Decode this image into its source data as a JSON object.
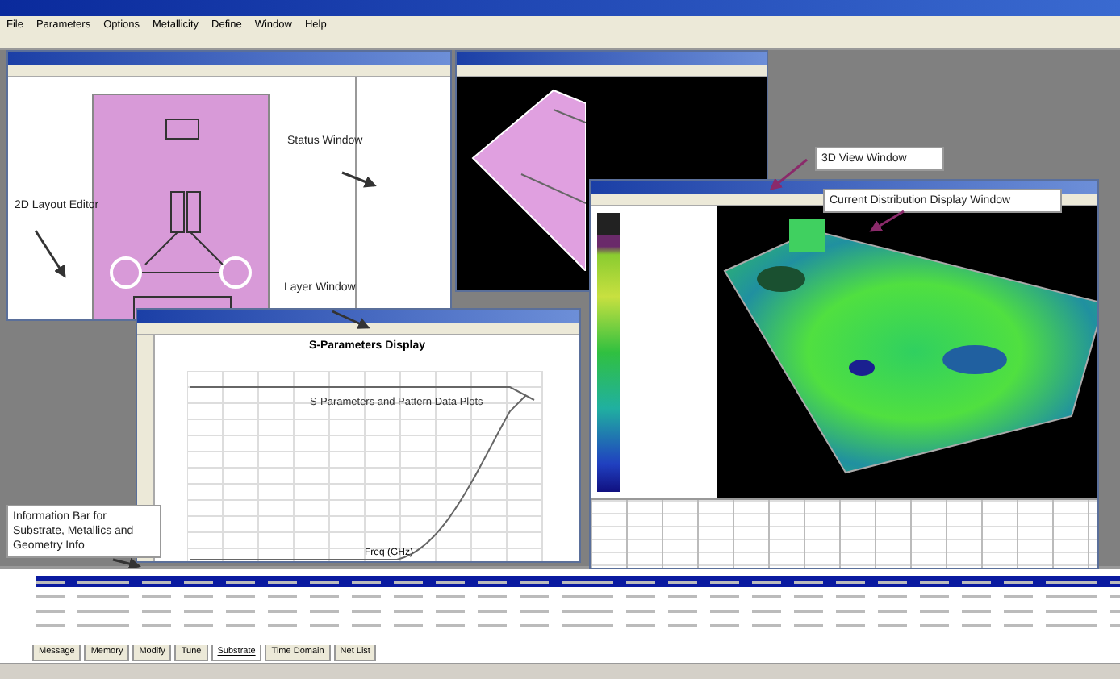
{
  "menu": [
    "File",
    "Parameters",
    "Options",
    "Metallicity",
    "Define",
    "Window",
    "Help"
  ],
  "callouts": [
    {
      "text": "2D Layout Editor",
      "boxed": false
    },
    {
      "text": "Status Window",
      "boxed": false
    },
    {
      "text": "Layer Window",
      "boxed": false
    },
    {
      "text": "3D View Window",
      "boxed": true
    },
    {
      "text": "Current Distribution Display Window",
      "boxed": true
    },
    {
      "text": "Information Bar for Substrate, Metallics and Geometry Info",
      "boxed": true
    }
  ],
  "s_parameters": {
    "title": "S-Parameters Display",
    "annotation": "S-Parameters and Pattern Data Plots",
    "xlabel": "Freq (GHz)"
  },
  "info_rows": [
    {
      "selected": true
    },
    {
      "selected": false
    },
    {
      "selected": false
    },
    {
      "selected": false
    }
  ],
  "tabs": [
    {
      "label": "Message",
      "selected": false
    },
    {
      "label": "Memory",
      "selected": false
    },
    {
      "label": "Modify",
      "selected": false
    },
    {
      "label": "Tune",
      "selected": false
    },
    {
      "label": "Substrate",
      "selected": true
    },
    {
      "label": "Time Domain",
      "selected": false
    },
    {
      "label": "Net List",
      "selected": false
    }
  ]
}
